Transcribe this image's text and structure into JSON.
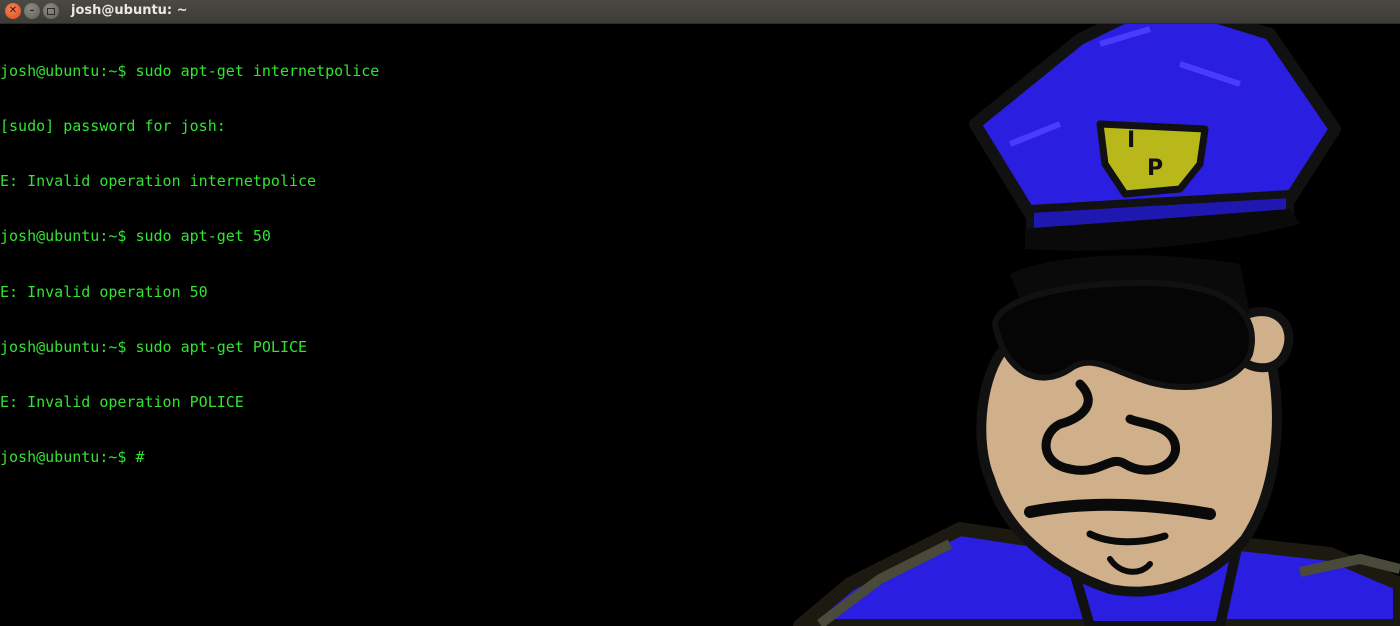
{
  "window": {
    "title": "josh@ubuntu: ~",
    "controls": [
      "close-icon",
      "minimize-icon",
      "maximize-icon"
    ]
  },
  "terminal": {
    "text_color": "#32e332",
    "background": "#000000",
    "lines": [
      "josh@ubuntu:~$ sudo apt-get internetpolice",
      "[sudo] password for josh:",
      "E: Invalid operation internetpolice",
      "josh@ubuntu:~$ sudo apt-get 50",
      "E: Invalid operation 50",
      "josh@ubuntu:~$ sudo apt-get POLICE",
      "E: Invalid operation POLICE",
      "josh@ubuntu:~$ #"
    ]
  },
  "badge": {
    "letter_top": "I",
    "letter_bottom": "P"
  },
  "colors": {
    "uniform_blue": "#2a1ee0",
    "badge_yellow": "#b8b81a",
    "skin": "#cfb08a"
  }
}
